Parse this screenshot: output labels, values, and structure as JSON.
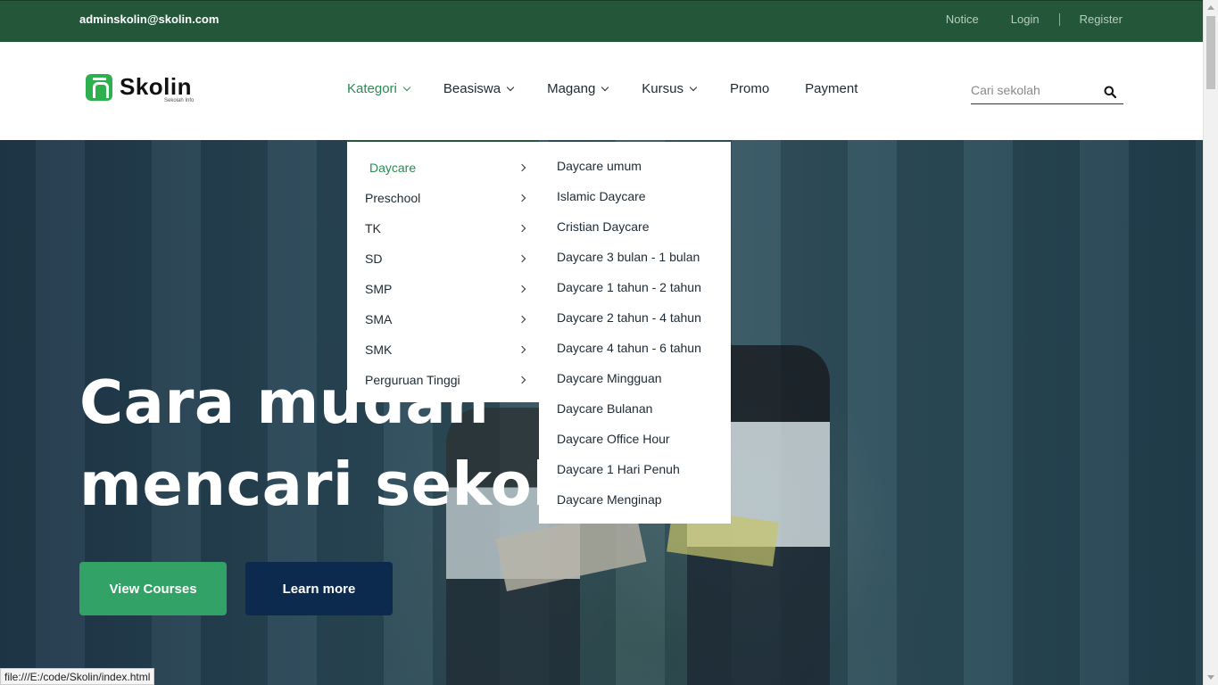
{
  "topbar": {
    "email": "adminskolin@skolin.com",
    "notice": "Notice",
    "login": "Login",
    "register": "Register"
  },
  "logo": {
    "name": "Skolin",
    "tagline": "Sekolah Info",
    "color": "#2eb04f"
  },
  "nav": {
    "items": [
      {
        "label": "Kategori"
      },
      {
        "label": "Beasiswa"
      },
      {
        "label": "Magang"
      },
      {
        "label": "Kursus"
      },
      {
        "label": "Promo"
      },
      {
        "label": "Payment"
      }
    ],
    "active": "Kategori"
  },
  "search": {
    "placeholder": "Cari sekolah",
    "icon": "search-icon"
  },
  "dropdown_kategori": {
    "items": [
      "Daycare",
      "Preschool",
      "TK",
      "SD",
      "SMP",
      "SMA",
      "SMK",
      "Perguruan Tinggi"
    ],
    "active": "Daycare"
  },
  "dropdown_daycare": {
    "items": [
      "Daycare umum",
      "Islamic Daycare",
      "Cristian Daycare",
      "Daycare 3 bulan - 1 bulan",
      "Daycare 1 tahun - 2 tahun",
      "Daycare 2 tahun - 4 tahun",
      "Daycare 4 tahun - 6 tahun",
      "Daycare Mingguan",
      "Daycare Bulanan",
      "Daycare Office Hour",
      "Daycare 1 Hari Penuh",
      "Daycare Menginap"
    ]
  },
  "hero": {
    "title_line1": "Cara mudah",
    "title_line2": "mencari sekolah",
    "view_courses": "View Courses",
    "learn_more": "Learn more"
  },
  "colors": {
    "topbar": "#24563a",
    "accent": "#33a266",
    "navy": "#0c2a4e",
    "active_text": "#2a8a55"
  },
  "status_url": "file:///E:/code/Skolin/index.html"
}
